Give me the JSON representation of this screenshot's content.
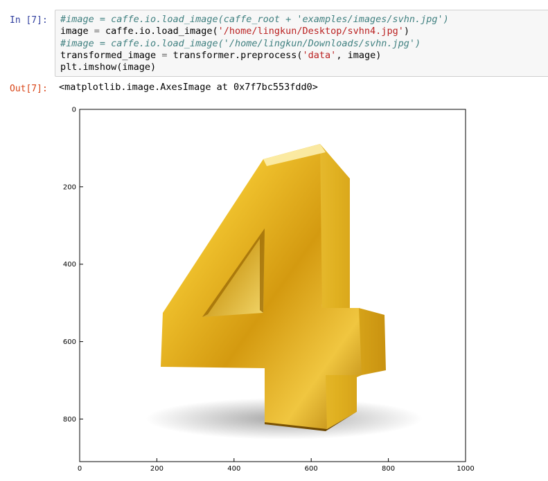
{
  "cell": {
    "in_prompt": "In [7]:",
    "out_prompt": "Out[7]:",
    "code_lines": [
      [
        {
          "t": "cm",
          "v": "#image = caffe.io.load_image(caffe_root + 'examples/images/svhn.jpg')"
        }
      ],
      [
        {
          "t": "nm",
          "v": "image "
        },
        {
          "t": "op",
          "v": "="
        },
        {
          "t": "nm",
          "v": " caffe.io.load_image("
        },
        {
          "t": "st",
          "v": "'/home/lingkun/Desktop/svhn4.jpg'"
        },
        {
          "t": "nm",
          "v": ")"
        }
      ],
      [
        {
          "t": "cm",
          "v": "#image = caffe.io.load_image('/home/lingkun/Downloads/svhn.jpg')"
        }
      ],
      [
        {
          "t": "nm",
          "v": "transformed_image "
        },
        {
          "t": "op",
          "v": "="
        },
        {
          "t": "nm",
          "v": " transformer.preprocess("
        },
        {
          "t": "st",
          "v": "'data'"
        },
        {
          "t": "nm",
          "v": ", image)"
        }
      ],
      [
        {
          "t": "nm",
          "v": "plt.imshow(image)"
        }
      ]
    ],
    "output_text": "<matplotlib.image.AxesImage at 0x7f7bc553fdd0>"
  },
  "chart_data": {
    "type": "image",
    "image_subject": "gold-3d-digit-4",
    "x_ticks": [
      0,
      200,
      400,
      600,
      800,
      1000
    ],
    "y_ticks": [
      0,
      200,
      400,
      600,
      800
    ],
    "xlim": [
      0,
      1000
    ],
    "ylim": [
      0,
      910
    ],
    "y_inverted": true,
    "grid": false
  }
}
